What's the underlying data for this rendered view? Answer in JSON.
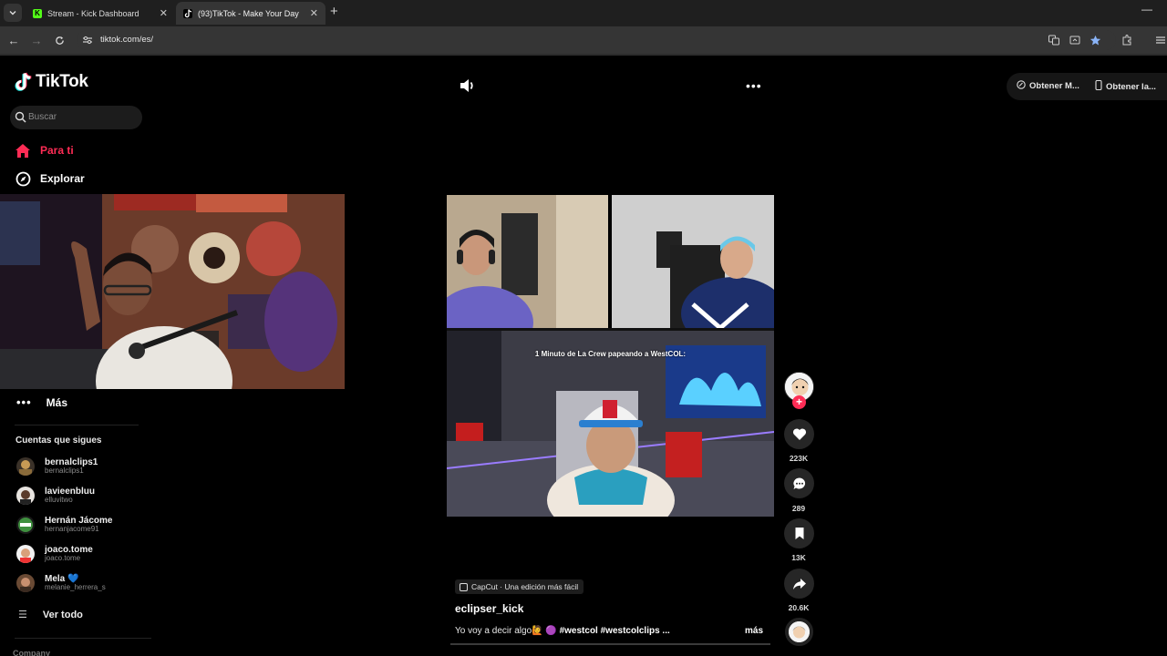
{
  "browser": {
    "tabs": [
      {
        "title": "Stream - Kick Dashboard",
        "favicon": "kick-icon",
        "active": false
      },
      {
        "title": "(93)TikTok - Make Your Day",
        "favicon": "tiktok-icon",
        "active": true
      }
    ],
    "url": "tiktok.com/es/"
  },
  "tiktok": {
    "logo_text": "TikTok",
    "search_placeholder": "Buscar",
    "nav": {
      "for_you": "Para ti",
      "explore": "Explorar",
      "more": "Más"
    },
    "following_title": "Cuentas que sigues",
    "following": [
      {
        "display": "bernalclips1",
        "handle": "bernalclips1"
      },
      {
        "display": "lavieenbluu",
        "handle": "elluvitwo"
      },
      {
        "display": "Hernán Jácome",
        "handle": "hernanjacome91"
      },
      {
        "display": "joaco.tome",
        "handle": "joaco.tome"
      },
      {
        "display": "Mela 💙",
        "handle": "melanie_herrera_s"
      }
    ],
    "see_all": "Ver todo",
    "company": "Company",
    "header_buttons": {
      "get_app": "Obtener M...",
      "get_desktop": "Obtener la..."
    },
    "video": {
      "overlay_text": "1 Minuto de La Crew papeando a WestCOL:",
      "capcut_label": "CapCut · Una edición más fácil",
      "author": "eclipser_kick",
      "caption_text": "Yo voy a decir algo🙋 🟣",
      "caption_tags": "#westcol #westcolclips ...",
      "caption_more": "más"
    },
    "actions": {
      "likes": "223K",
      "comments": "289",
      "saves": "13K",
      "shares": "20.6K"
    },
    "colors": {
      "accent": "#fe2c55",
      "background": "#000000"
    }
  }
}
